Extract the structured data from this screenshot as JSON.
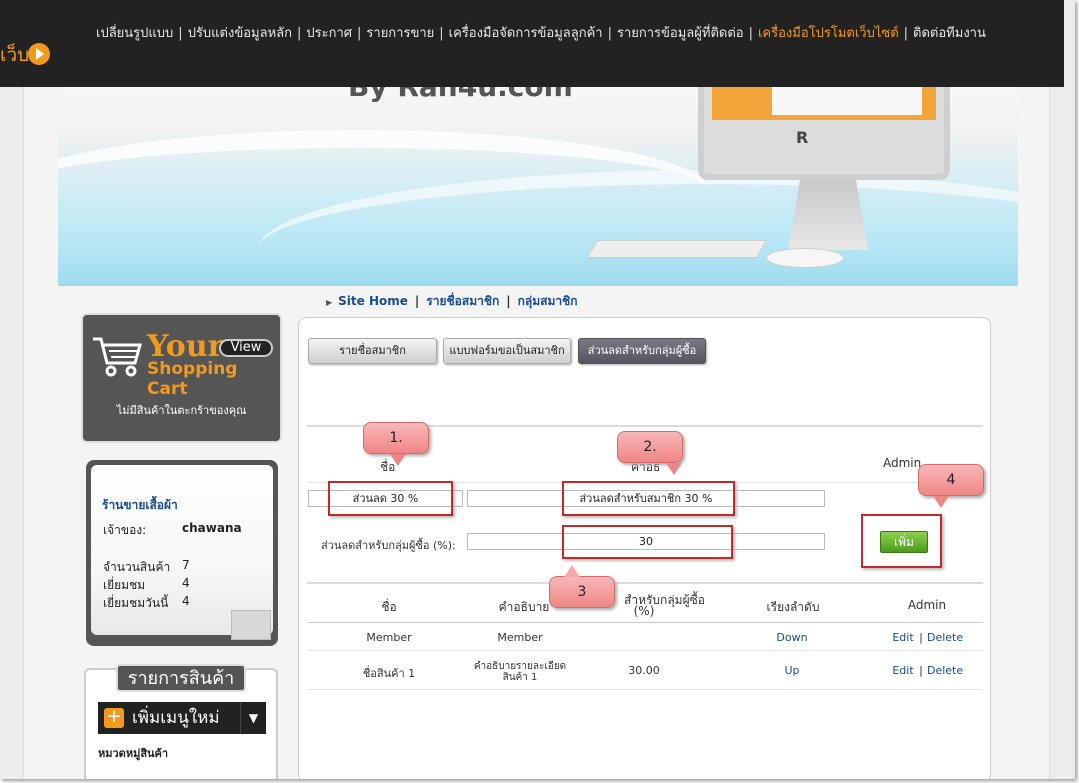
{
  "topbar": {
    "logo_text": "เว็บ",
    "menu": [
      "เปลี่ยนรูปแบบ",
      "ปรับแต่งข้อมูลหลัก",
      "ประกาศ",
      "รายการขาย",
      "เครื่องมือจัดการข้อมูลลูกค้า",
      "รายการข้อมูลผู้ที่ติดต่อ",
      "เครื่องมือโปรโมตเว็บไซต์",
      "ติดต่อทีมงาน"
    ],
    "separator": "|",
    "accent_color": "#f39a1d"
  },
  "banner": {
    "by_text": "By Ran4u.com",
    "monitor_logo": "R"
  },
  "breadcrumb": {
    "items": [
      "Site Home",
      "รายชื่อสมาชิก",
      "กลุ่มสมาชิก"
    ],
    "separator": "|"
  },
  "cart": {
    "your": "Your",
    "view": "View",
    "shopping_cart": "Shopping Cart",
    "empty_text": "ไม่มีสินค้าในตะกร้าของคุณ"
  },
  "shop": {
    "name": "ร้านขายเสื้อผ้า",
    "owner_label": "เจ้าของ:",
    "owner_value": "chawana",
    "products_label": "จำนวนสินค้า",
    "products_value": "7",
    "visits_label": "เยี่ยมชม",
    "visits_value": "4",
    "visits_today_label": "เยี่ยมชมวันนี้",
    "visits_today_value": "4"
  },
  "products": {
    "title": "รายการสินค้า",
    "add_menu": "เพิ่มเมนูใหม่",
    "plus": "+",
    "caret": "▼",
    "category": "หมวดหมู่สินค้า"
  },
  "tabs": [
    "รายชื่อสมาชิก",
    "แบบฟอร์มขอเป็นสมาชิก",
    "ส่วนลดสำหรับกลุ่มผู้ซื้อ"
  ],
  "form": {
    "col_name": "ชื่อ",
    "col_detail": "คำอธิ",
    "col_admin": "Admin",
    "name_value": "ส่วนลด 30 %",
    "detail_value": "ส่วนลดสำหรับสมาชิก 30 %",
    "discount_label": "ส่วนลดสำหรับกลุ่มผู้ซื้อ (%):",
    "discount_value": "30",
    "add_button": "เพิ่ม"
  },
  "table": {
    "headers": [
      "ชื่อ",
      "คำอธิบาย",
      "สำหรับกลุ่มผู้ซื้อ",
      "(%)",
      "เรียงลำดับ",
      "Admin"
    ],
    "rows": [
      {
        "name": "Member",
        "desc": "Member",
        "percent": "",
        "order": "Down",
        "edit": "Edit",
        "sep": "|",
        "delete": "Delete"
      },
      {
        "name": "ชื่อสินค้า 1",
        "desc": "คำอธิบายรายละเอียด",
        "desc2": "สินค้า 1",
        "percent": "30.00",
        "order": "Up",
        "edit": "Edit",
        "sep": "|",
        "delete": "Delete"
      }
    ]
  },
  "callouts": [
    "1.",
    "2.",
    "3",
    "4"
  ],
  "annotation_color": "#c32a2a"
}
